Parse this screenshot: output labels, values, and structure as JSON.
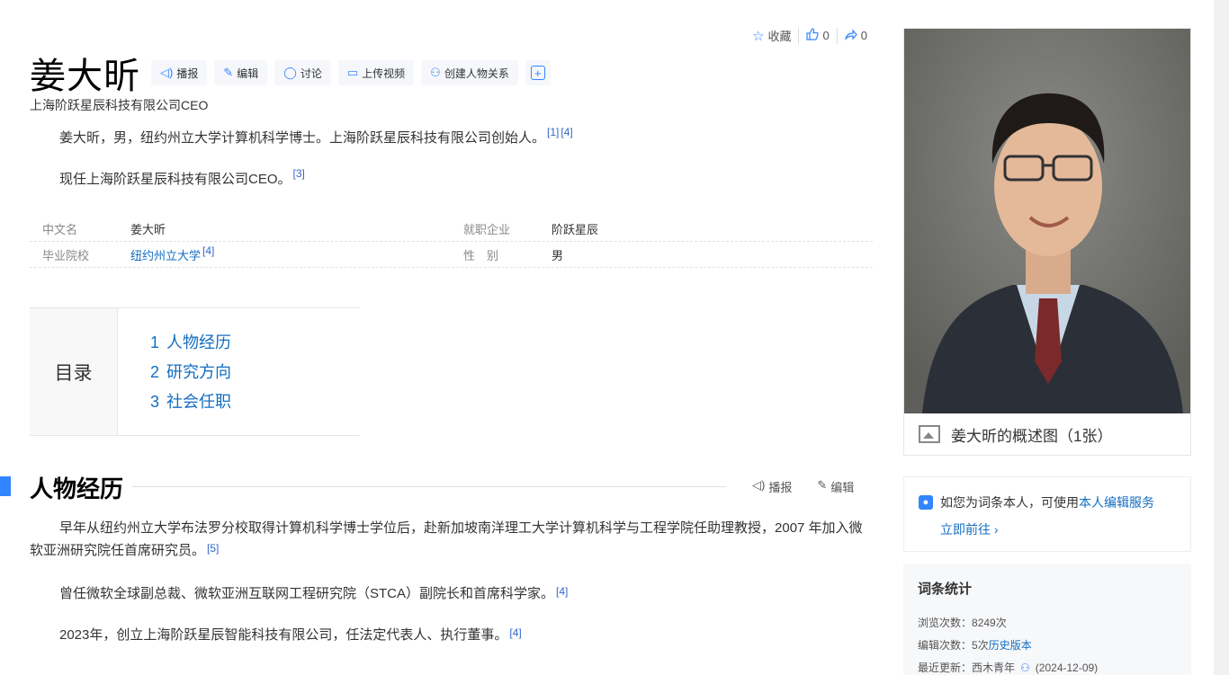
{
  "top_actions": {
    "collect_label": "收藏",
    "like_count": "0",
    "share_count": "0"
  },
  "title": "姜大昕",
  "pills": [
    "播报",
    "编辑",
    "讨论",
    "上传视频",
    "创建人物关系"
  ],
  "subtitle": "上海阶跃星辰科技有限公司CEO",
  "lead": [
    {
      "text": "姜大昕，男，纽约州立大学计算机科学博士。上海阶跃星辰科技有限公司创始人。",
      "refs": [
        "[1]",
        "[4]"
      ]
    },
    {
      "text": "现任上海阶跃星辰科技有限公司CEO。",
      "refs": [
        "[3]"
      ]
    }
  ],
  "basic_info": [
    {
      "left_key": "中文名",
      "left_val": "姜大昕",
      "right_key": "就职企业",
      "right_val": "阶跃星辰"
    },
    {
      "left_key": "毕业院校",
      "left_val": "纽约州立大学",
      "left_ref": "[4]",
      "right_key": "性　别",
      "right_val": "男"
    }
  ],
  "catalog": {
    "title": "目录",
    "items": [
      {
        "num": "1",
        "label": "人物经历"
      },
      {
        "num": "2",
        "label": "研究方向"
      },
      {
        "num": "3",
        "label": "社会任职"
      }
    ]
  },
  "section": {
    "title": "人物经历",
    "tool_read": "播报",
    "tool_edit": "编辑"
  },
  "body": [
    {
      "text": "早年从纽约州立大学布法罗分校取得计算机科学博士学位后，赴新加坡南洋理工大学计算机科学与工程学院任助理教授，2007 年加入微软亚洲研究院任首席研究员。",
      "ref": "[5]"
    },
    {
      "text": "曾任微软全球副总裁、微软亚洲互联网工程研究院（STCA）副院长和首席科学家。",
      "ref": "[4]"
    },
    {
      "text": "2023年，创立上海阶跃星辰智能科技有限公司，任法定代表人、执行董事。",
      "ref": "[4]"
    }
  ],
  "portrait": {
    "caption": "姜大昕的概述图（1张）"
  },
  "service": {
    "text": "如您为词条本人，可使用",
    "link": "本人编辑服务",
    "go": "立即前往 ›"
  },
  "stats": {
    "title": "词条统计",
    "views_label": "浏览次数：",
    "views": "8249次",
    "edits_label": "编辑次数：",
    "edits": "5次",
    "history": "历史版本",
    "updated_label": "最近更新：",
    "updated_user": "西木青年",
    "updated_date": "(2024-12-09)"
  },
  "colors": {
    "accent": "#3385ff",
    "link": "#136ec2"
  },
  "icons": [
    "star-icon",
    "thumb-up-icon",
    "share-icon",
    "speaker-icon",
    "pencil-icon",
    "chat-icon",
    "video-icon",
    "relation-icon",
    "plus-icon",
    "picture-icon",
    "person-icon",
    "medal-icon"
  ]
}
